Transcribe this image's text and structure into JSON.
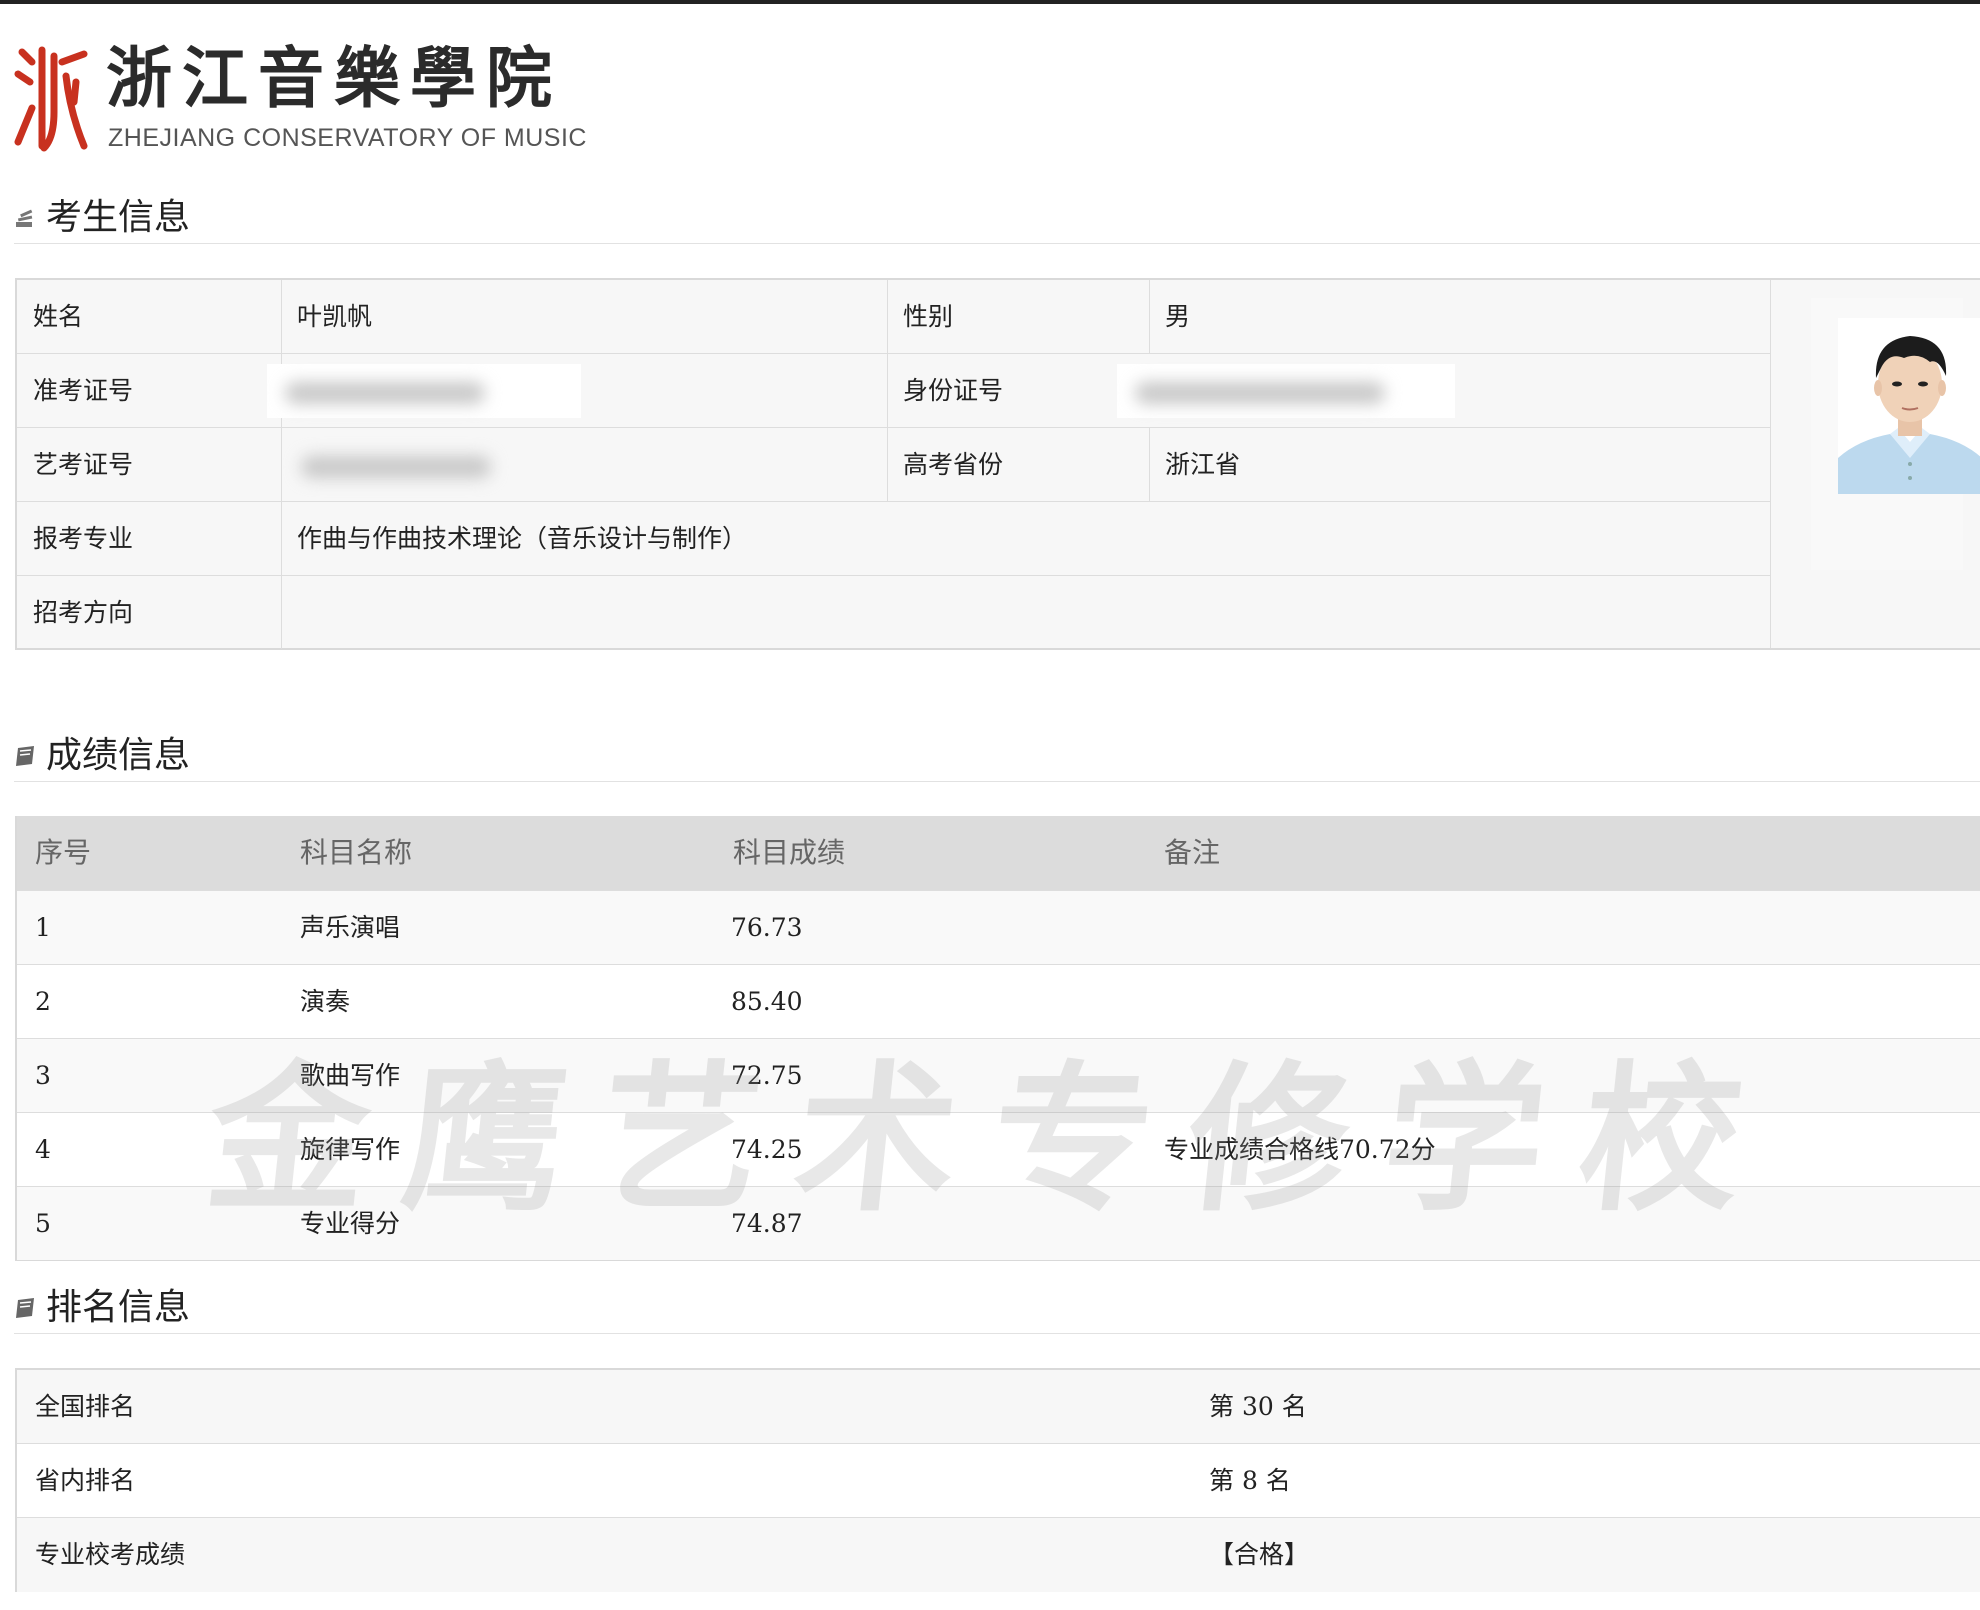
{
  "header": {
    "logo_cn": "浙江音樂學院",
    "logo_en": "ZHEJIANG CONSERVATORY OF MUSIC",
    "logo_mark": "浙",
    "logo_color": "#c8311f"
  },
  "candidate": {
    "title": "考生信息",
    "name_label": "姓名",
    "name_value": "叶凯帆",
    "gender_label": "性别",
    "gender_value": "男",
    "admission_label": "准考证号",
    "id_label": "身份证号",
    "art_exam_label": "艺考证号",
    "province_label": "高考省份",
    "province_value": "浙江省",
    "major_label": "报考专业",
    "major_value": "作曲与作曲技术理论（音乐设计与制作）",
    "direction_label": "招考方向",
    "direction_value": ""
  },
  "scores": {
    "title": "成绩信息",
    "headers": [
      "序号",
      "科目名称",
      "科目成绩",
      "备注"
    ],
    "rows": [
      {
        "no": "1",
        "subject": "声乐演唱",
        "score": "76.73",
        "note": ""
      },
      {
        "no": "2",
        "subject": "演奏",
        "score": "85.40",
        "note": ""
      },
      {
        "no": "3",
        "subject": "歌曲写作",
        "score": "72.75",
        "note": ""
      },
      {
        "no": "4",
        "subject": "旋律写作",
        "score": "74.25",
        "note": "专业成绩合格线70.72分"
      },
      {
        "no": "5",
        "subject": "专业得分",
        "score": "74.87",
        "note": ""
      }
    ]
  },
  "watermark": "金鹰艺术专修学校",
  "ranking": {
    "title": "排名信息",
    "rows": [
      {
        "label": "全国排名",
        "value": "第 30 名"
      },
      {
        "label": "省内排名",
        "value": "第 8 名"
      },
      {
        "label": "专业校考成绩",
        "value": "【合格】"
      }
    ]
  }
}
